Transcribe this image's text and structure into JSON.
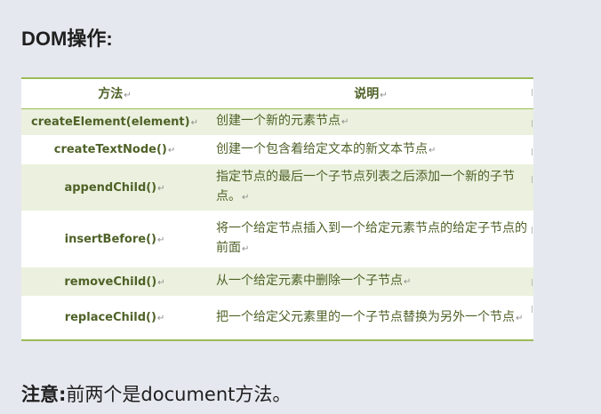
{
  "heading": "DOM操作:",
  "table": {
    "header_method": "方法",
    "header_desc": "说明",
    "rows": [
      {
        "method": "createElement(element)",
        "desc": "创建一个新的元素节点"
      },
      {
        "method": "createTextNode()",
        "desc": "创建一个包含着给定文本的新文本节点"
      },
      {
        "method": "appendChild()",
        "desc": "指定节点的最后一个子节点列表之后添加一个新的子节点。"
      },
      {
        "method": "insertBefore()",
        "desc": "将一个给定节点插入到一个给定元素节点的给定子节点的前面"
      },
      {
        "method": "removeChild()",
        "desc": "从一个给定元素中删除一个子节点"
      },
      {
        "method": "replaceChild()",
        "desc": "把一个给定父元素里的一个子节点替换为另外一个节点"
      }
    ]
  },
  "paragraph_mark": "↵",
  "note": {
    "label": "注意:",
    "text": "前两个是document方法。"
  },
  "colors": {
    "page_background": "#e6e8ef",
    "table_text": "#4f6228",
    "table_border": "#9bbb59",
    "row_shade": "#ebf1de"
  }
}
